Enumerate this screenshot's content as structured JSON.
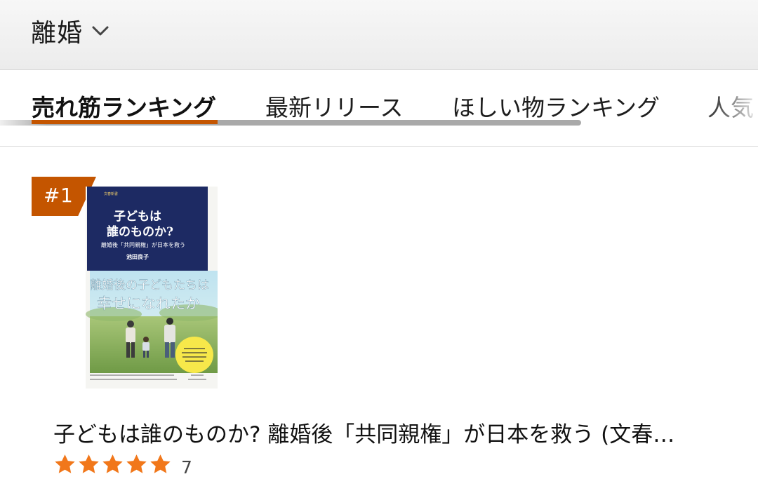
{
  "header": {
    "title": "離婚",
    "icon": "chevron-down-icon"
  },
  "tabs": [
    {
      "label": "売れ筋ランキング",
      "active": true
    },
    {
      "label": "最新リリース",
      "active": false
    },
    {
      "label": "ほしい物ランキング",
      "active": false
    },
    {
      "label": "人気",
      "active": false
    }
  ],
  "product": {
    "rank": "#1",
    "title": "子どもは誰のものか? 離婚後「共同親権」が日本を救う (文春…",
    "rating": 5,
    "rating_count": "7",
    "cover": {
      "publisher_line": "文春新書",
      "title_line1": "子どもは",
      "title_line2": "誰のものか?",
      "subtitle": "離婚後「共同親権」が日本を救う",
      "author": "池田良子",
      "band_line1": "離婚後の子どもたちは",
      "band_line2": "幸せになれたか"
    }
  },
  "colors": {
    "accent": "#c45500",
    "star": "#f1771a",
    "cover_navy": "#1d2a63"
  }
}
